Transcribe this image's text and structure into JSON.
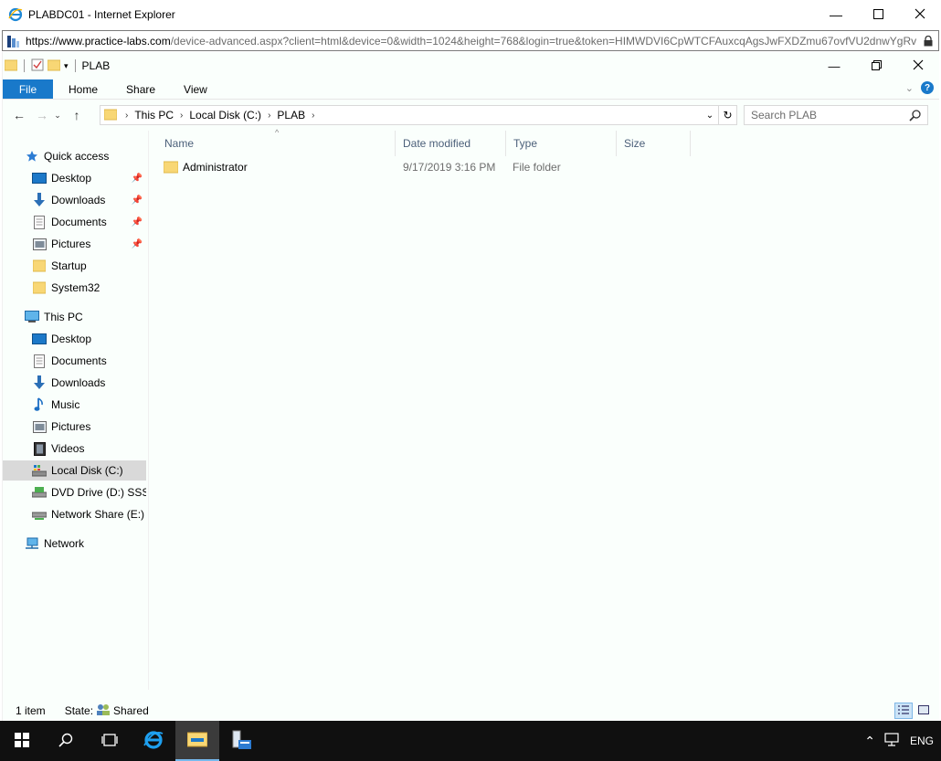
{
  "browser": {
    "title": "PLABDC01 - Internet Explorer",
    "url_host": "https://www.practice-labs.com",
    "url_path": "/device-advanced.aspx?client=html&device=0&width=1024&height=768&login=true&token=HIMWDVI6CpWTCFAuxcqAgsJwFXDZmu67ovfVU2dnwYgRv"
  },
  "explorer": {
    "title": "PLAB",
    "tabs": [
      "File",
      "Home",
      "Share",
      "View"
    ],
    "breadcrumb": [
      "This PC",
      "Local Disk (C:)",
      "PLAB"
    ],
    "search_placeholder": "Search PLAB"
  },
  "navpane": {
    "quick_access": "Quick access",
    "quick_items": [
      "Desktop",
      "Downloads",
      "Documents",
      "Pictures",
      "Startup",
      "System32"
    ],
    "this_pc": "This PC",
    "pc_items": [
      "Desktop",
      "Documents",
      "Downloads",
      "Music",
      "Pictures",
      "Videos",
      "Local Disk (C:)",
      "DVD Drive (D:) SSS_X",
      "Network Share (E:)"
    ],
    "network": "Network"
  },
  "columns": [
    "Name",
    "Date modified",
    "Type",
    "Size"
  ],
  "files": [
    {
      "name": "Administrator",
      "date": "9/17/2019 3:16 PM",
      "type": "File folder",
      "size": ""
    }
  ],
  "status": {
    "count": "1 item",
    "state_label": "State:",
    "state_value": "Shared"
  },
  "tray": {
    "lang": "ENG"
  }
}
